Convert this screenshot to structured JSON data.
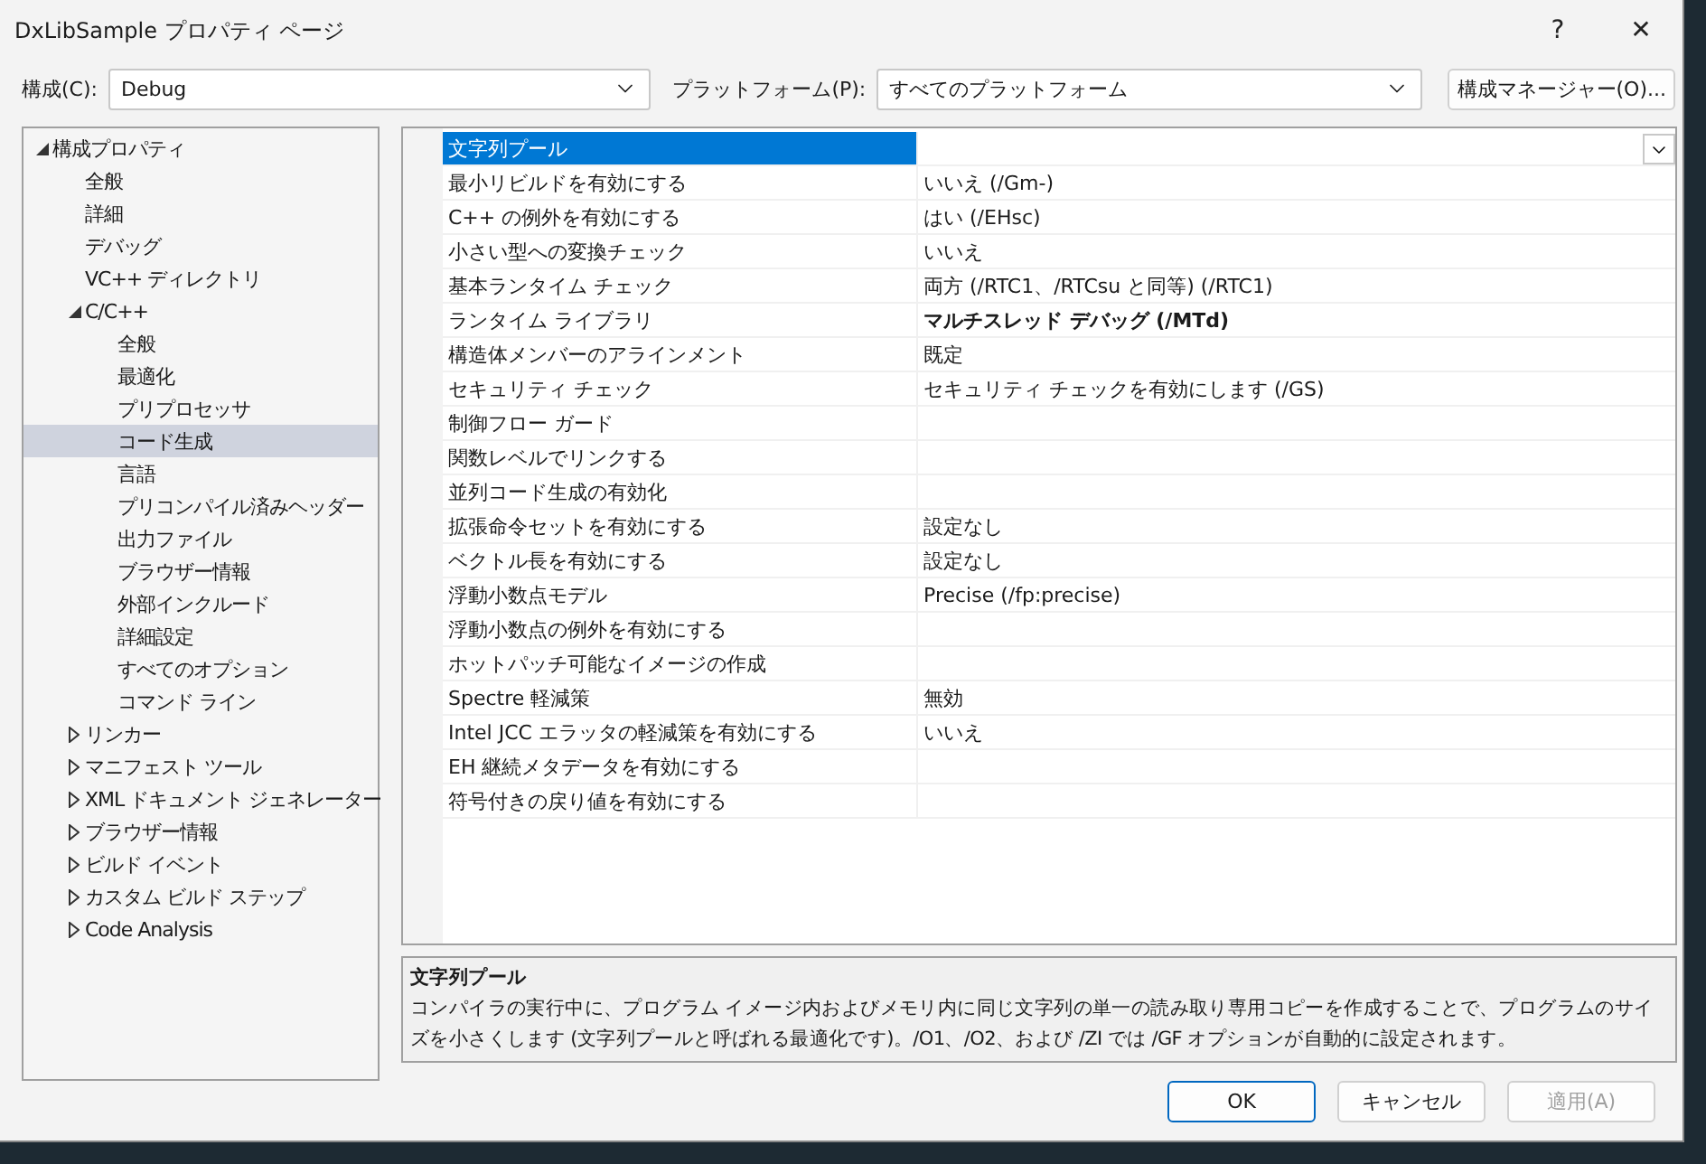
{
  "window": {
    "title": "DxLibSample プロパティ ページ",
    "help": "?",
    "close": "✕"
  },
  "config_bar": {
    "configuration": {
      "label": "構成(C):",
      "value": "Debug"
    },
    "platform": {
      "label": "プラットフォーム(P):",
      "value": "すべてのプラットフォーム"
    },
    "manager_button": "構成マネージャー(O)..."
  },
  "tree": [
    {
      "label": "構成プロパティ",
      "expanded": true,
      "selected": false,
      "children": [
        {
          "label": "全般",
          "selected": false
        },
        {
          "label": "詳細",
          "selected": false
        },
        {
          "label": "デバッグ",
          "selected": false
        },
        {
          "label": "VC++ ディレクトリ",
          "selected": false
        },
        {
          "label": "C/C++",
          "expanded": true,
          "selected": false,
          "children": [
            {
              "label": "全般",
              "selected": false
            },
            {
              "label": "最適化",
              "selected": false
            },
            {
              "label": "プリプロセッサ",
              "selected": false
            },
            {
              "label": "コード生成",
              "selected": true
            },
            {
              "label": "言語",
              "selected": false
            },
            {
              "label": "プリコンパイル済みヘッダー",
              "selected": false
            },
            {
              "label": "出力ファイル",
              "selected": false
            },
            {
              "label": "ブラウザー情報",
              "selected": false
            },
            {
              "label": "外部インクルード",
              "selected": false
            },
            {
              "label": "詳細設定",
              "selected": false
            },
            {
              "label": "すべてのオプション",
              "selected": false
            },
            {
              "label": "コマンド ライン",
              "selected": false
            }
          ]
        },
        {
          "label": "リンカー",
          "expanded": false,
          "selected": false
        },
        {
          "label": "マニフェスト ツール",
          "expanded": false,
          "selected": false
        },
        {
          "label": "XML ドキュメント ジェネレーター",
          "expanded": false,
          "selected": false
        },
        {
          "label": "ブラウザー情報",
          "expanded": false,
          "selected": false
        },
        {
          "label": "ビルド イベント",
          "expanded": false,
          "selected": false
        },
        {
          "label": "カスタム ビルド ステップ",
          "expanded": false,
          "selected": false
        },
        {
          "label": "Code Analysis",
          "expanded": false,
          "selected": false
        }
      ]
    }
  ],
  "properties": [
    {
      "name": "文字列プール",
      "selected": true
    },
    {
      "name": "最小リビルドを有効にする",
      "value": "いいえ (/Gm-)",
      "selected": false,
      "modified": false
    },
    {
      "name": "C++ の例外を有効にする",
      "value": "はい (/EHsc)",
      "selected": false,
      "modified": false
    },
    {
      "name": "小さい型への変換チェック",
      "value": "いいえ",
      "selected": false,
      "modified": false
    },
    {
      "name": "基本ランタイム チェック",
      "value": "両方 (/RTC1、/RTCsu と同等) (/RTC1)",
      "selected": false,
      "modified": false
    },
    {
      "name": "ランタイム ライブラリ",
      "value": "マルチスレッド デバッグ (/MTd)",
      "selected": false,
      "modified": true
    },
    {
      "name": "構造体メンバーのアラインメント",
      "value": "既定",
      "selected": false,
      "modified": false
    },
    {
      "name": "セキュリティ チェック",
      "value": "セキュリティ チェックを有効にします (/GS)",
      "selected": false,
      "modified": false
    },
    {
      "name": "制御フロー ガード",
      "selected": false
    },
    {
      "name": "関数レベルでリンクする",
      "selected": false
    },
    {
      "name": "並列コード生成の有効化",
      "selected": false
    },
    {
      "name": "拡張命令セットを有効にする",
      "value": "設定なし",
      "selected": false,
      "modified": false
    },
    {
      "name": "ベクトル長を有効にする",
      "value": "設定なし",
      "selected": false,
      "modified": false
    },
    {
      "name": "浮動小数点モデル",
      "value": "Precise (/fp:precise)",
      "selected": false,
      "modified": false
    },
    {
      "name": "浮動小数点の例外を有効にする",
      "selected": false
    },
    {
      "name": "ホットパッチ可能なイメージの作成",
      "selected": false
    },
    {
      "name": "Spectre 軽減策",
      "value": "無効",
      "selected": false,
      "modified": false
    },
    {
      "name": "Intel JCC エラッタの軽減策を有効にする",
      "value": "いいえ",
      "selected": false,
      "modified": false
    },
    {
      "name": "EH 継続メタデータを有効にする",
      "selected": false
    },
    {
      "name": "符号付きの戻り値を有効にする",
      "selected": false
    }
  ],
  "description": {
    "title": "文字列プール",
    "text": "コンパイラの実行中に、プログラム イメージ内およびメモリ内に同じ文字列の単一の読み取り専用コピーを作成することで、プログラムのサイズを小さくします (文字列プールと呼ばれる最適化です)。/O1、/O2、および /ZI では /GF オプションが自動的に設定されます。"
  },
  "buttons": [
    {
      "label": "OK",
      "kind": "default",
      "disabled": false
    },
    {
      "label": "キャンセル",
      "kind": "normal",
      "disabled": false
    },
    {
      "label": "適用(A)",
      "kind": "normal",
      "disabled": true
    }
  ]
}
